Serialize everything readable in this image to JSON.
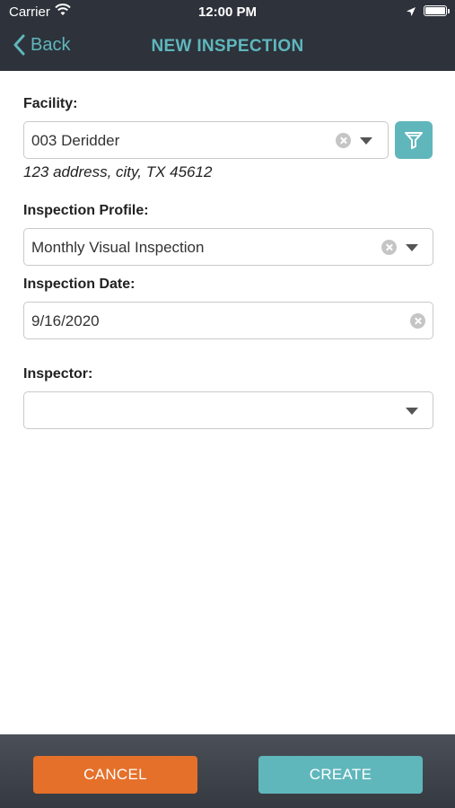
{
  "status_bar": {
    "carrier": "Carrier",
    "time": "12:00 PM"
  },
  "nav": {
    "back_label": "Back",
    "title": "NEW INSPECTION"
  },
  "form": {
    "facility": {
      "label": "Facility:",
      "value": "003 Deridder",
      "address": "123 address, city, TX 45612"
    },
    "profile": {
      "label": "Inspection Profile:",
      "value": "Monthly Visual Inspection"
    },
    "date": {
      "label": "Inspection Date:",
      "value": "9/16/2020"
    },
    "inspector": {
      "label": "Inspector:",
      "value": ""
    }
  },
  "actions": {
    "cancel_label": "CANCEL",
    "create_label": "CREATE"
  },
  "colors": {
    "accent": "#5fb7bc",
    "cancel": "#e5702a",
    "header": "#2d323b"
  },
  "icons": [
    "wifi-icon",
    "location-arrow-icon",
    "battery-icon",
    "chevron-left-icon",
    "clear-icon",
    "caret-down-icon",
    "filter-icon"
  ]
}
